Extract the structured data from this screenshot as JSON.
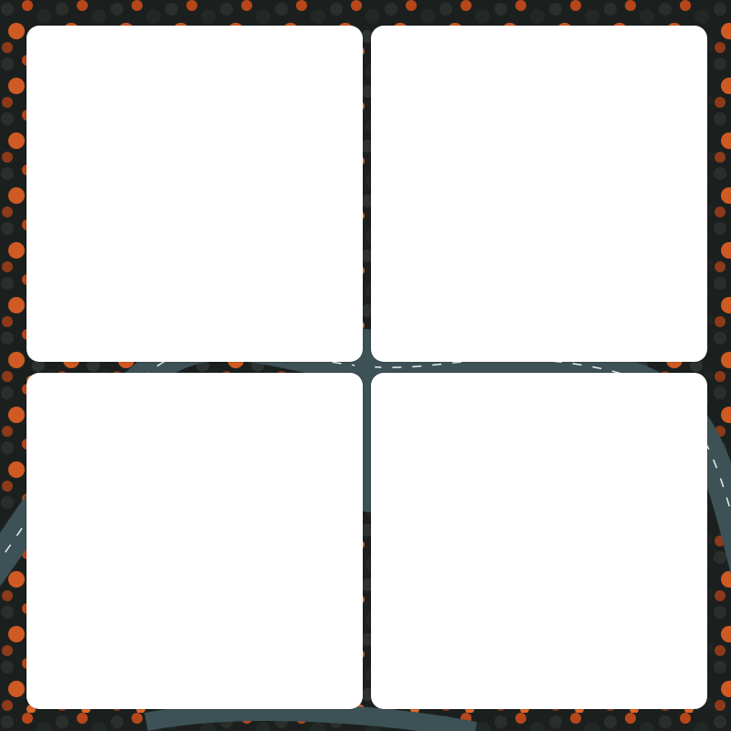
{
  "colors": {
    "tile_fill": "#ffffff",
    "foliage_dark": "#1b201f",
    "foliage_autumn": "#c8501f",
    "foliage_bright": "#e0692b",
    "road": "#3d5256",
    "road_marking": "#e8eef0"
  },
  "tiles": [
    {
      "id": "top-left"
    },
    {
      "id": "top-right"
    },
    {
      "id": "bottom-left"
    },
    {
      "id": "bottom-right"
    }
  ]
}
